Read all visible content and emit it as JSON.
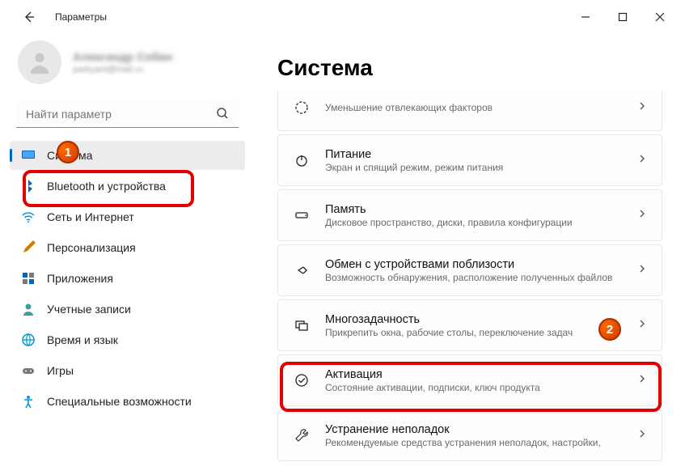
{
  "window": {
    "title": "Параметры"
  },
  "user": {
    "name": "Александр Собин",
    "email": "parkyard@mail.ru"
  },
  "search": {
    "placeholder": "Найти параметр"
  },
  "sidebar": {
    "items": [
      {
        "label": "Система",
        "icon": "monitor"
      },
      {
        "label": "Bluetooth и устройства",
        "icon": "bluetooth"
      },
      {
        "label": "Сеть и Интернет",
        "icon": "wifi"
      },
      {
        "label": "Персонализация",
        "icon": "brush"
      },
      {
        "label": "Приложения",
        "icon": "apps"
      },
      {
        "label": "Учетные записи",
        "icon": "person"
      },
      {
        "label": "Время и язык",
        "icon": "globe"
      },
      {
        "label": "Игры",
        "icon": "gamepad"
      },
      {
        "label": "Специальные возможности",
        "icon": "accessibility"
      }
    ]
  },
  "page": {
    "heading": "Система"
  },
  "cards": [
    {
      "title": "",
      "sub": "Уменьшение отвлекающих факторов",
      "icon": "focus",
      "partial": true
    },
    {
      "title": "Питание",
      "sub": "Экран и спящий режим, режим питания",
      "icon": "power"
    },
    {
      "title": "Память",
      "sub": "Дисковое пространство, диски, правила конфигурации",
      "icon": "storage"
    },
    {
      "title": "Обмен с устройствами поблизости",
      "sub": "Возможность обнаружения, расположение полученных файлов",
      "icon": "share"
    },
    {
      "title": "Многозадачность",
      "sub": "Прикрепить окна, рабочие столы, переключение задач",
      "icon": "multitask"
    },
    {
      "title": "Активация",
      "sub": "Состояние активации, подписки, ключ продукта",
      "icon": "check"
    },
    {
      "title": "Устранение неполадок",
      "sub": "Рекомендуемые средства устранения неполадок, настройки,",
      "icon": "wrench"
    }
  ],
  "annotations": {
    "badge1": "1",
    "badge2": "2"
  }
}
